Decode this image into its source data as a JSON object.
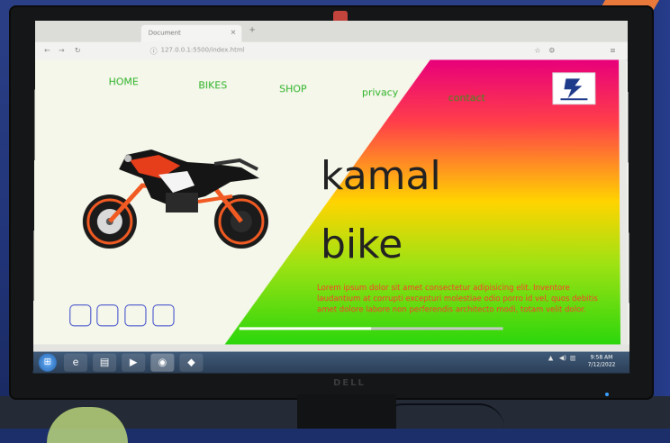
{
  "browser": {
    "tab_title": "Document",
    "url": "127.0.0.1:5500/index.html"
  },
  "site": {
    "nav": [
      "HOME",
      "BIKES",
      "SHOP",
      "privacy",
      "contact"
    ],
    "hero_line1": "kamal",
    "hero_line2": "bike",
    "description": "Lorem ipsum dolor sit amet consectetur adipisicing elit. Inventore laudantium at corrupti excepturi molestiae odio porro id vel, quos debitis amet dolore labore non perferendis architecto modi, totam velit dolor.",
    "thumbnail_count": 4,
    "progress": 0.5,
    "colors": {
      "nav_text": "#2fb32a",
      "description_text": "#ff3b2b",
      "gradient_top": "#e8007a",
      "gradient_mid": "#ffd400",
      "gradient_bottom": "#2bd60c",
      "thumbnail_border": "#3746c9"
    },
    "logo_icon": "bike-brand-logo-icon"
  },
  "taskbar": {
    "time": "9:58 AM",
    "date": "7/12/2022",
    "icons": [
      "windows-start-icon",
      "internet-explorer-icon",
      "file-explorer-icon",
      "media-player-icon",
      "firefox-icon",
      "vscode-icon"
    ]
  },
  "monitor": {
    "brand": "DELL"
  }
}
